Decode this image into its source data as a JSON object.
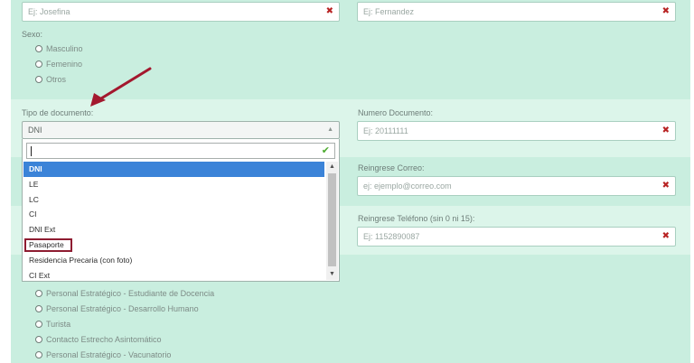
{
  "form": {
    "nombre": {
      "placeholder": "Ej: Josefina"
    },
    "apellido": {
      "placeholder": "Ej: Fernandez"
    },
    "sexo": {
      "label": "Sexo:",
      "options": [
        "Masculino",
        "Femenino",
        "Otros"
      ]
    },
    "tipo_documento": {
      "label": "Tipo de documento:",
      "selected": "DNI",
      "search_value": "",
      "options": [
        "DNI",
        "LE",
        "LC",
        "CI",
        "DNI Ext",
        "Pasaporte",
        "Residencia Precaria (con foto)",
        "CI Ext"
      ],
      "highlighted_option": "Pasaporte"
    },
    "numero_documento": {
      "label": "Numero Documento:",
      "placeholder": "Ej: 20111111"
    },
    "correo": {
      "label": "Reingrese Correo:",
      "placeholder": "ej: ejemplo@correo.com"
    },
    "telefono": {
      "label": "Reingrese Teléfono (sin 0 ni 15):",
      "placeholder": "Ej: 1152890087"
    },
    "categoria": {
      "options": [
        "Personal Estratégico - Estudiante de Docencia",
        "Personal Estratégico - Desarrollo Humano",
        "Turista",
        "Contacto Estrecho Asintomático",
        "Personal Estratégico - Vacunatorio"
      ]
    }
  },
  "icons": {
    "clear": "close-icon",
    "valid": "checkmark-icon",
    "caret": "caret-up-icon",
    "pointer": "red-arrow-annotation"
  },
  "colors": {
    "panel": "#c9eedf",
    "band": "#dcf5ea",
    "selected_option": "#3b83d8",
    "clear_icon": "#b82323",
    "annotation": "#8e1c31",
    "valid_icon": "#4caa2f"
  }
}
